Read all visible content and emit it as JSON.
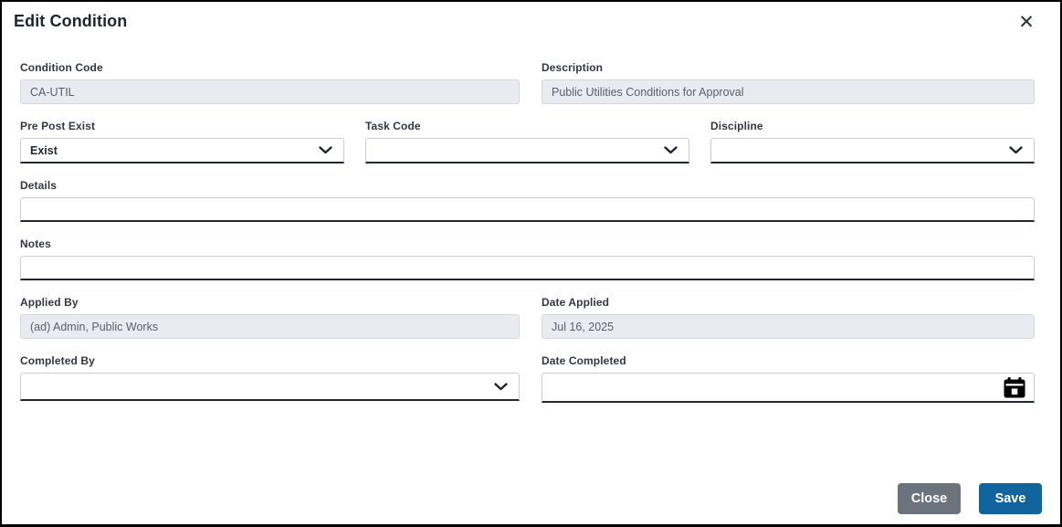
{
  "modal": {
    "title": "Edit Condition",
    "close_icon_glyph": "✕"
  },
  "fields": {
    "condition_code": {
      "label": "Condition Code",
      "value": "CA-UTIL",
      "readonly": true
    },
    "description": {
      "label": "Description",
      "value": "Public Utilities Conditions for Approval",
      "readonly": true
    },
    "pre_post_exist": {
      "label": "Pre Post Exist",
      "value": "Exist",
      "type": "dropdown"
    },
    "task_code": {
      "label": "Task Code",
      "value": "",
      "type": "dropdown"
    },
    "discipline": {
      "label": "Discipline",
      "value": "",
      "type": "dropdown"
    },
    "details": {
      "label": "Details",
      "value": ""
    },
    "notes": {
      "label": "Notes",
      "value": ""
    },
    "applied_by": {
      "label": "Applied By",
      "value": "(ad) Admin, Public Works",
      "readonly": true
    },
    "date_applied": {
      "label": "Date Applied",
      "value": "Jul 16, 2025",
      "readonly": true
    },
    "completed_by": {
      "label": "Completed By",
      "value": "",
      "type": "dropdown"
    },
    "date_completed": {
      "label": "Date Completed",
      "value": "",
      "type": "date"
    }
  },
  "footer": {
    "close_label": "Close",
    "save_label": "Save"
  },
  "icons": {
    "close": "close-icon",
    "chevron": "chevron-down-icon",
    "calendar": "calendar-icon"
  },
  "colors": {
    "save_button": "#11649E",
    "close_button": "#6D737C",
    "disabled_field_bg": "#EAEBF0",
    "field_border": "#C9CDD2",
    "field_bottom_border": "#23272E",
    "title_text": "#1F2430",
    "modal_border": "#000000"
  }
}
